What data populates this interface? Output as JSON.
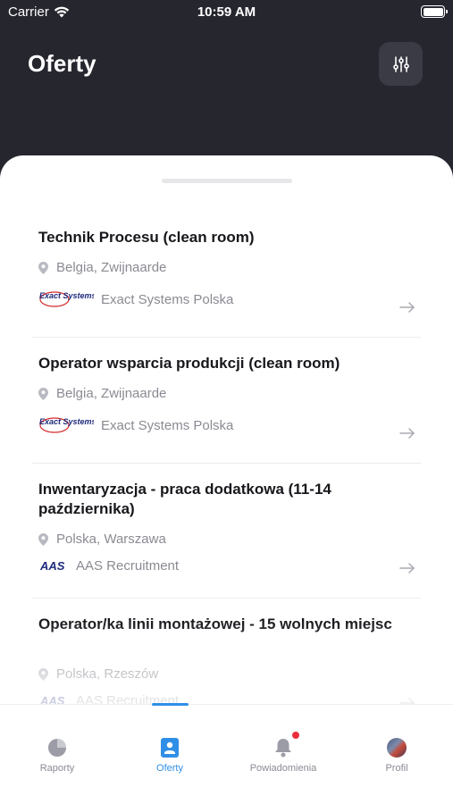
{
  "status_bar": {
    "carrier": "Carrier",
    "time": "10:59 AM"
  },
  "header": {
    "title": "Oferty"
  },
  "jobs": [
    {
      "title": "Technik Procesu (clean room)",
      "location": "Belgia, Zwijnaarde",
      "company": "Exact Systems Polska",
      "logo_text": "Exact Systems"
    },
    {
      "title": "Operator wsparcia produkcji (clean room)",
      "location": "Belgia, Zwijnaarde",
      "company": "Exact Systems Polska",
      "logo_text": "Exact Systems"
    },
    {
      "title": "Inwentaryzacja - praca dodatkowa (11-14 października)",
      "location": "Polska, Warszawa",
      "company": "AAS Recruitment",
      "logo_text": "AAS"
    },
    {
      "title": "Operator/ka linii montażowej - 15 wolnych miejsc",
      "location": "Polska, Rzeszów",
      "company": "AAS Recruitment",
      "logo_text": "AAS"
    }
  ],
  "tabs": [
    {
      "label": "Raporty",
      "icon": "pie-chart-icon",
      "active": false
    },
    {
      "label": "Oferty",
      "icon": "badge-icon",
      "active": true
    },
    {
      "label": "Powiadomienia",
      "icon": "bell-icon",
      "active": false
    },
    {
      "label": "Profil",
      "icon": "avatar",
      "active": false
    }
  ],
  "colors": {
    "header_bg": "#26262f",
    "accent": "#2f8fe6",
    "notification": "#ea2e3b"
  }
}
